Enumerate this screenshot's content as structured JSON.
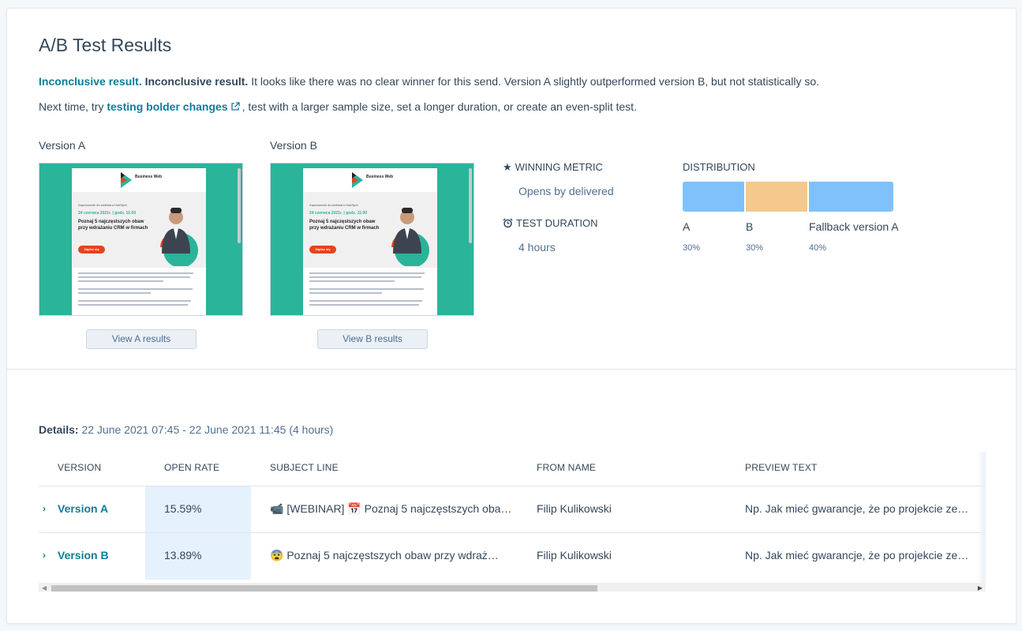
{
  "page": {
    "title": "A/B Test Results",
    "summary": {
      "result_link": "Inconclusive result.",
      "result_bold": "Inconclusive result.",
      "result_text": " It looks like there was no clear winner for this send. Version A slightly outperformed version B, but not statistically so."
    },
    "advice": {
      "prefix": "Next time, try ",
      "link": "testing bolder changes",
      "suffix": ", test with a larger sample size, set a longer duration, or create an even-split test."
    }
  },
  "versions": [
    {
      "label": "Version A",
      "button": "View A results",
      "preview": {
        "brand": "Business Web",
        "line1": "Zaproszenie do webinaru HubSpot",
        "line2": "24 czerwca 2021r. | godz. 11:00",
        "headline": "Poznaj 5 najczęstszych obaw przy wdrażaniu CRM w firmach",
        "cta": "Zapisz się"
      }
    },
    {
      "label": "Version B",
      "button": "View B results",
      "preview": {
        "brand": "Business Web",
        "line1": "Zaproszenie do webinaru HubSpot",
        "line2": "24 czerwca 2021r. | godz. 11:00",
        "headline": "Poznaj 5 najczęstszych obaw przy wdrażaniu CRM w firmach",
        "cta": "Zapisz się"
      }
    }
  ],
  "metrics": {
    "winning_metric_label": "WINNING METRIC",
    "winning_metric_value": "Opens by delivered",
    "test_duration_label": "TEST DURATION",
    "test_duration_value": "4 hours"
  },
  "distribution": {
    "label": "DISTRIBUTION",
    "segments": [
      {
        "name": "A",
        "percent_label": "30%",
        "value": 30,
        "color": "#7fc1fb"
      },
      {
        "name": "B",
        "percent_label": "30%",
        "value": 30,
        "color": "#f5c88e"
      },
      {
        "name": "Fallback version A",
        "percent_label": "40%",
        "value": 40,
        "color": "#7fc1fb"
      }
    ]
  },
  "details": {
    "label": "Details:",
    "value": " 22 June 2021 07:45 - 22 June 2021 11:45 (4 hours)"
  },
  "table": {
    "headers": [
      "VERSION",
      "OPEN RATE",
      "SUBJECT LINE",
      "FROM NAME",
      "PREVIEW TEXT"
    ],
    "rows": [
      {
        "version": "Version A",
        "open_rate": "15.59%",
        "subject": "📹 [WEBINAR] 📅 Poznaj 5 najczęstszych oba…",
        "from_name": "Filip Kulikowski",
        "preview_text": "Np. Jak mieć gwarancje, że po projekcie ze…"
      },
      {
        "version": "Version B",
        "open_rate": "13.89%",
        "subject": "😨 Poznaj 5 najczęstszych obaw przy wdraż…",
        "from_name": "Filip Kulikowski",
        "preview_text": "Np. Jak mieć gwarancje, że po projekcie ze…"
      }
    ]
  },
  "colors": {
    "accent": "#0b7e97",
    "preview_bg": "#2ab49a",
    "open_rate_highlight": "#e5f1fc"
  }
}
